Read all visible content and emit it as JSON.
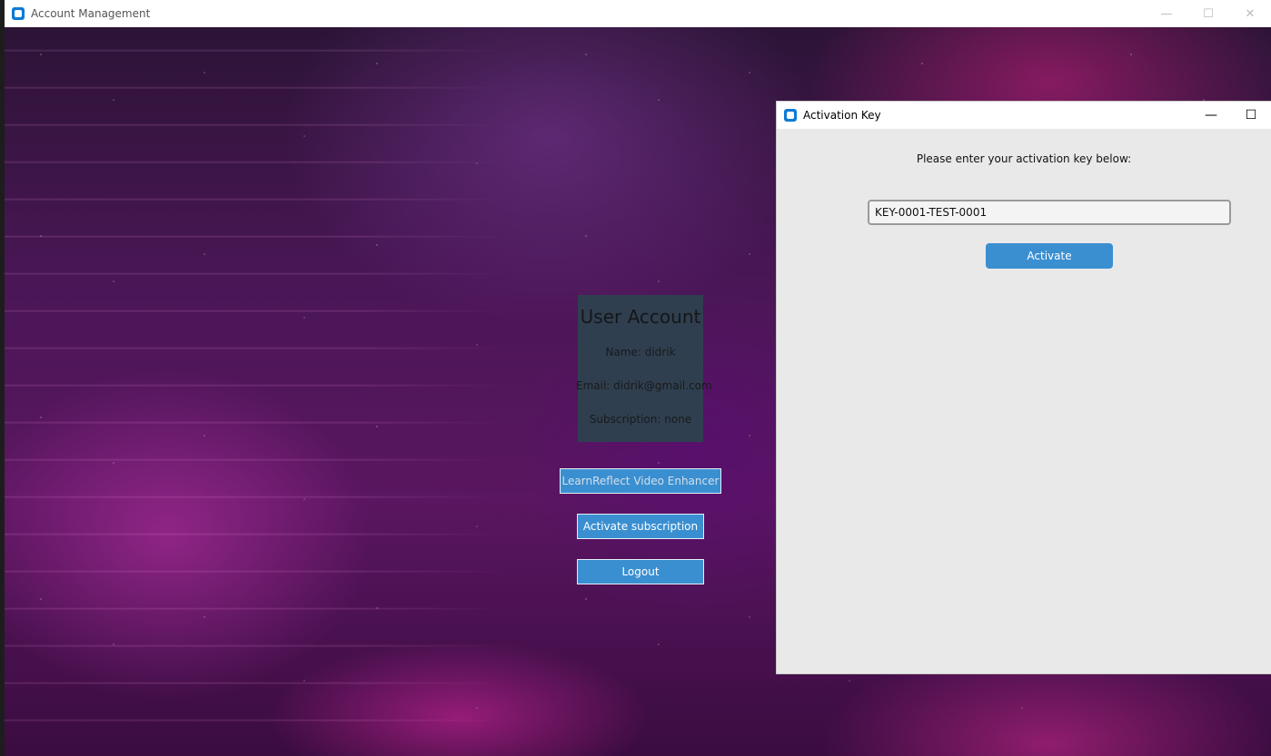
{
  "main_window": {
    "title": "Account Management",
    "controls": {
      "minimize": "—",
      "maximize": "☐",
      "close": "✕"
    }
  },
  "user_card": {
    "title": "User Account",
    "name": "Name: didrik",
    "email": "Email: didrik@gmail.com",
    "subscription": "Subscription: none"
  },
  "buttons": {
    "enhancer": "LearnReflect Video Enhancer",
    "activate_subscription": "Activate subscription",
    "logout": "Logout"
  },
  "dialog": {
    "title": "Activation Key",
    "controls": {
      "minimize": "—",
      "maximize": "☐"
    },
    "prompt": "Please enter your activation key below:",
    "key_value": "KEY-0001-TEST-0001",
    "activate_label": "Activate"
  },
  "colors": {
    "accent_button": "#3a8fd1",
    "card_bg": "#2f3f50",
    "dialog_bg": "#e9e9e9"
  }
}
